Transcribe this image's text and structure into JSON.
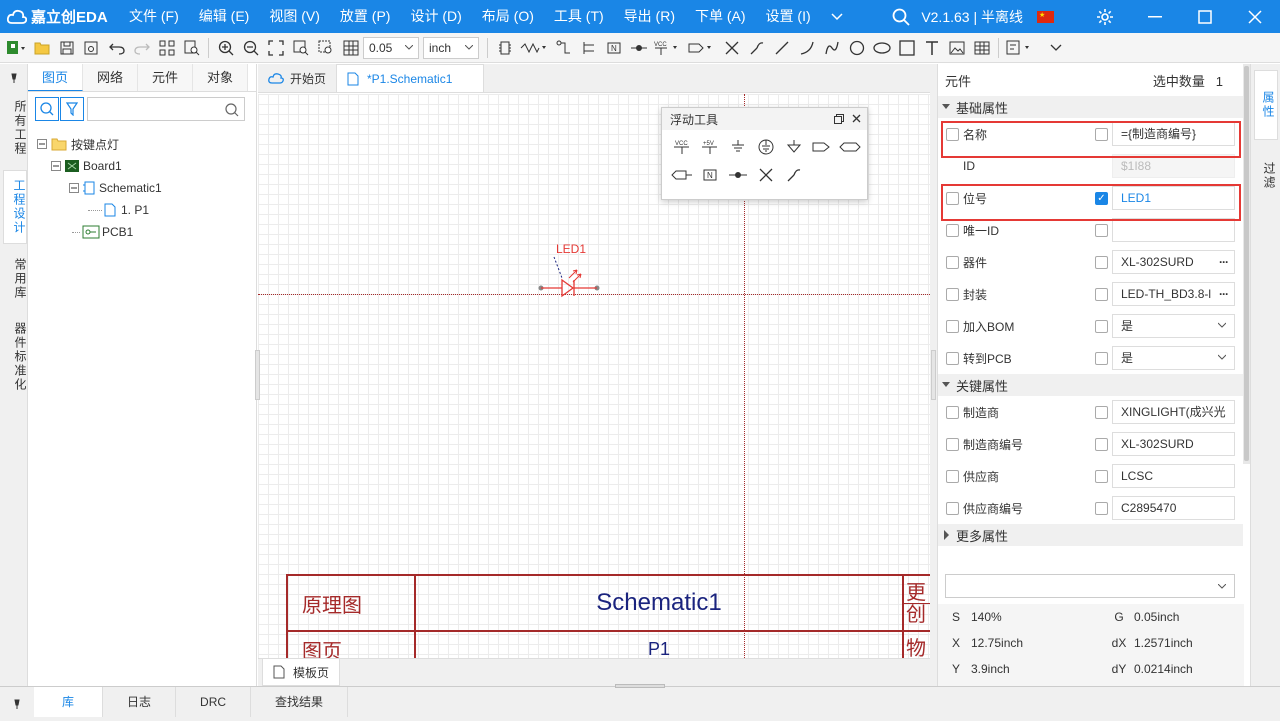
{
  "app": {
    "logo": "嘉立创EDA",
    "menu": [
      "文件 (F)",
      "编辑 (E)",
      "视图 (V)",
      "放置 (P)",
      "设计 (D)",
      "布局 (O)",
      "工具 (T)",
      "导出 (R)",
      "下单 (A)",
      "设置 (I)"
    ],
    "version": "V2.1.63 | 半离线"
  },
  "toolbar": {
    "grid_value": "0.05",
    "unit": "inch"
  },
  "left_strip": {
    "tabs": [
      "所有工程",
      "工程设计",
      "常用库",
      "器件标准化"
    ]
  },
  "left_panel": {
    "tabs": [
      "图页",
      "网络",
      "元件",
      "对象"
    ],
    "search_placeholder": "",
    "tree": [
      {
        "label": "按键点灯",
        "level": 0,
        "icon": "folder-icon"
      },
      {
        "label": "Board1",
        "level": 1,
        "icon": "board-icon"
      },
      {
        "label": "Schematic1",
        "level": 2,
        "icon": "schematic-icon"
      },
      {
        "label": "1. P1",
        "level": 3,
        "icon": "page-icon"
      },
      {
        "label": "PCB1",
        "level": 1,
        "icon": "pcb-icon"
      }
    ]
  },
  "canvas": {
    "tabs": [
      "开始页",
      "*P1.Schematic1"
    ],
    "bottom_tab": "模板页",
    "component_label": "LED1",
    "float_tool_title": "浮动工具",
    "titleblock": {
      "r1c1": "原理图",
      "r1c2": "Schematic1",
      "r1c3": "更",
      "r1c3b": "创",
      "r2c1": "图页",
      "r2c2": "P1",
      "r2c3": "物"
    }
  },
  "properties": {
    "header": "元件",
    "selected_label": "选中数量",
    "selected_count": "1",
    "section_basic": "基础属性",
    "section_key": "关键属性",
    "section_more": "更多属性",
    "rows_basic": [
      {
        "label": "名称",
        "value": "={制造商编号}",
        "checked": false,
        "style": "normal"
      },
      {
        "label": "ID",
        "value": "$1I88",
        "checked": false,
        "style": "disabled",
        "nocheck": true
      },
      {
        "label": "位号",
        "value": "LED1",
        "checked": true,
        "style": "blue"
      },
      {
        "label": "唯一ID",
        "value": "",
        "checked": false,
        "style": "normal"
      },
      {
        "label": "器件",
        "value": "XL-302SURD",
        "checked": false,
        "style": "dots"
      },
      {
        "label": "封装",
        "value": "LED-TH_BD3.8-l",
        "checked": false,
        "style": "dots"
      },
      {
        "label": "加入BOM",
        "value": "是",
        "checked": false,
        "style": "select"
      },
      {
        "label": "转到PCB",
        "value": "是",
        "checked": false,
        "style": "select"
      }
    ],
    "rows_key": [
      {
        "label": "制造商",
        "value": "XINGLIGHT(成兴光"
      },
      {
        "label": "制造商编号",
        "value": "XL-302SURD"
      },
      {
        "label": "供应商",
        "value": "LCSC"
      },
      {
        "label": "供应商编号",
        "value": "C2895470"
      }
    ],
    "status": {
      "S": "140%",
      "G": "0.05inch",
      "X": "12.75inch",
      "dX": "1.2571inch",
      "Y": "3.9inch",
      "dY": "0.0214inch"
    }
  },
  "right_strip": {
    "tabs": [
      "属性",
      "过滤"
    ]
  },
  "footer": {
    "tabs": [
      "库",
      "日志",
      "DRC",
      "查找结果"
    ]
  }
}
